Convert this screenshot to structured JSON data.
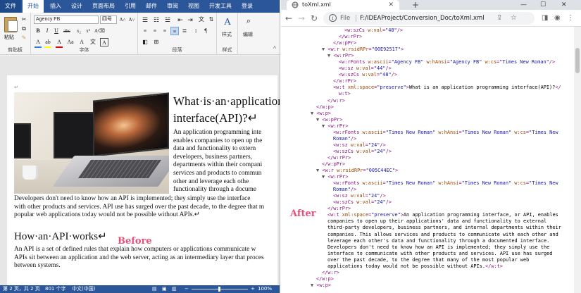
{
  "word": {
    "ribbon_tabs": [
      "文件",
      "开始",
      "插入",
      "设计",
      "页面布局",
      "引用",
      "邮件",
      "审阅",
      "视图",
      "开发工具",
      "登录"
    ],
    "active_tab": "开始",
    "paste_label": "粘贴",
    "clipboard_label": "剪贴板",
    "font_name": "Agency FB",
    "font_size": "四号",
    "font_group_label": "字体",
    "paragraph_group_label": "段落",
    "styles_label": "样式",
    "styles_group_label": "样式",
    "editing_label": "编辑",
    "document": {
      "para_mark": "↵",
      "heading1_lines": [
        "What·is·an·application·pr",
        "interface(API)?↵"
      ],
      "para1_beside": [
        "An application programming inte",
        "enables companies to open up the",
        "data and functionality to extern",
        "developers, business partners,",
        "departments within their compani",
        "services and products to commun",
        "other and leverage each othe",
        "functionality through a docume"
      ],
      "para1_full": [
        "Developers don't need to know how an API is implemented; they simply use the interface",
        "with other products and services. API use has surged over the past decade, to the degree that m",
        "popular web applications today would not be possible without APIs.↵"
      ],
      "heading2": "How·an·API·works↵",
      "para2": [
        "An API is a set of defined rules that explain how computers or applications communicate w",
        "APIs sit between an application and the web server, acting as an intermediary layer that proces",
        "between systems."
      ]
    },
    "before_label": "Before",
    "status": {
      "page": "第 2 页，共 2 页",
      "words": "801 个字",
      "language": "中文(中国)",
      "zoom": "100%"
    }
  },
  "browser": {
    "tab_title": "toXml.xml",
    "new_tab": "+",
    "file_label": "File",
    "url": "F:/IDEAProject/Conversion_Doc/toXml.xml",
    "after_label": "After",
    "xml_lines": [
      [
        4,
        [
          [
            "tag",
            "<w:szCs "
          ],
          [
            "an",
            "w:val"
          ],
          [
            "tag",
            "="
          ],
          [
            "av",
            "\"48\""
          ],
          [
            "tag",
            "/>"
          ]
        ]
      ],
      [
        3,
        [
          [
            "tag",
            "</w:rPr>"
          ]
        ]
      ],
      [
        2,
        [
          [
            "tag",
            "</w:pPr>"
          ]
        ]
      ],
      [
        0,
        [
          [
            "ar",
            "▼ "
          ],
          [
            "tag",
            "<w:r "
          ],
          [
            "an",
            "w:rsidRPr"
          ],
          [
            "tag",
            "="
          ],
          [
            "av",
            "\"00E92517\""
          ],
          [
            "tag",
            ">"
          ]
        ]
      ],
      [
        1,
        [
          [
            "ar",
            "▼ "
          ],
          [
            "tag",
            "<w:rPr>"
          ]
        ]
      ],
      [
        3,
        [
          [
            "tag",
            "<w:rFonts "
          ],
          [
            "an",
            "w:ascii"
          ],
          [
            "tag",
            "="
          ],
          [
            "av",
            "\"Agency FB\""
          ],
          [
            "tag",
            " "
          ],
          [
            "an",
            "w:hAnsi"
          ],
          [
            "tag",
            "="
          ],
          [
            "av",
            "\"Agency FB\""
          ],
          [
            "tag",
            " "
          ],
          [
            "an",
            "w:cs"
          ],
          [
            "tag",
            "="
          ],
          [
            "av",
            "\"Times New Roman\""
          ],
          [
            "tag",
            "/>"
          ]
        ]
      ],
      [
        3,
        [
          [
            "tag",
            "<w:sz "
          ],
          [
            "an",
            "w:val"
          ],
          [
            "tag",
            "="
          ],
          [
            "av",
            "\"44\""
          ],
          [
            "tag",
            "/>"
          ]
        ]
      ],
      [
        3,
        [
          [
            "tag",
            "<w:szCs "
          ],
          [
            "an",
            "w:val"
          ],
          [
            "tag",
            "="
          ],
          [
            "av",
            "\"48\""
          ],
          [
            "tag",
            "/>"
          ]
        ]
      ],
      [
        2,
        [
          [
            "tag",
            "</w:rPr>"
          ]
        ]
      ],
      [
        2,
        [
          [
            "tag",
            "<w:t "
          ],
          [
            "an",
            "xml:space"
          ],
          [
            "tag",
            "="
          ],
          [
            "av",
            "\"preserve\""
          ],
          [
            "tag",
            ">"
          ],
          [
            "tx",
            "What is an application programming interface(API)?"
          ],
          [
            "tag",
            "</"
          ]
        ]
      ],
      [
        3,
        [
          [
            "tag",
            "w:t>"
          ]
        ]
      ],
      [
        1,
        [
          [
            "tag",
            "</w:r>"
          ]
        ]
      ],
      [
        -1,
        [
          [
            "tag",
            "</w:p>"
          ]
        ]
      ],
      [
        -2,
        [
          [
            "ar",
            "▼ "
          ],
          [
            "tag",
            "<w:p>"
          ]
        ]
      ],
      [
        -1,
        [
          [
            "ar",
            "▼ "
          ],
          [
            "tag",
            "<w:pPr>"
          ]
        ]
      ],
      [
        0,
        [
          [
            "ar",
            "▼ "
          ],
          [
            "tag",
            "<w:rPr>"
          ]
        ]
      ],
      [
        2,
        [
          [
            "tag",
            "<w:rFonts "
          ],
          [
            "an",
            "w:ascii"
          ],
          [
            "tag",
            "="
          ],
          [
            "av",
            "\"Times New Roman\""
          ],
          [
            "tag",
            " "
          ],
          [
            "an",
            "w:hAnsi"
          ],
          [
            "tag",
            "="
          ],
          [
            "av",
            "\"Times New Roman\""
          ],
          [
            "tag",
            " "
          ],
          [
            "an",
            "w:cs"
          ],
          [
            "tag",
            "="
          ],
          [
            "av",
            "\"Times New"
          ]
        ]
      ],
      [
        2,
        [
          [
            "av",
            "Roman\""
          ],
          [
            "tag",
            "/>"
          ]
        ]
      ],
      [
        2,
        [
          [
            "tag",
            "<w:sz "
          ],
          [
            "an",
            "w:val"
          ],
          [
            "tag",
            "="
          ],
          [
            "av",
            "\"24\""
          ],
          [
            "tag",
            "/>"
          ]
        ]
      ],
      [
        2,
        [
          [
            "tag",
            "<w:szCs "
          ],
          [
            "an",
            "w:val"
          ],
          [
            "tag",
            "="
          ],
          [
            "av",
            "\"24\""
          ],
          [
            "tag",
            "/>"
          ]
        ]
      ],
      [
        1,
        [
          [
            "tag",
            "</w:rPr>"
          ]
        ]
      ],
      [
        0,
        [
          [
            "tag",
            "</w:pPr>"
          ]
        ]
      ],
      [
        -1,
        [
          [
            "ar",
            "▼ "
          ],
          [
            "tag",
            "<w:r "
          ],
          [
            "an",
            "w:rsidRPr"
          ],
          [
            "tag",
            "="
          ],
          [
            "av",
            "\"005C44EC\""
          ],
          [
            "tag",
            ">"
          ]
        ]
      ],
      [
        0,
        [
          [
            "ar",
            "▼ "
          ],
          [
            "tag",
            "<w:rPr>"
          ]
        ]
      ],
      [
        2,
        [
          [
            "tag",
            "<w:rFonts "
          ],
          [
            "an",
            "w:ascii"
          ],
          [
            "tag",
            "="
          ],
          [
            "av",
            "\"Times New Roman\""
          ],
          [
            "tag",
            " "
          ],
          [
            "an",
            "w:hAnsi"
          ],
          [
            "tag",
            "="
          ],
          [
            "av",
            "\"Times New Roman\""
          ],
          [
            "tag",
            " "
          ],
          [
            "an",
            "w:cs"
          ],
          [
            "tag",
            "="
          ],
          [
            "av",
            "\"Times New"
          ]
        ]
      ],
      [
        2,
        [
          [
            "av",
            "Roman\""
          ],
          [
            "tag",
            "/>"
          ]
        ]
      ],
      [
        2,
        [
          [
            "tag",
            "<w:sz "
          ],
          [
            "an",
            "w:val"
          ],
          [
            "tag",
            "="
          ],
          [
            "av",
            "\"24\""
          ],
          [
            "tag",
            "/>"
          ]
        ]
      ],
      [
        2,
        [
          [
            "tag",
            "<w:szCs "
          ],
          [
            "an",
            "w:val"
          ],
          [
            "tag",
            "="
          ],
          [
            "av",
            "\"24\""
          ],
          [
            "tag",
            "/>"
          ]
        ]
      ],
      [
        1,
        [
          [
            "tag",
            "</w:rPr>"
          ]
        ]
      ],
      [
        1,
        [
          [
            "tag",
            "<w:t "
          ],
          [
            "an",
            "xml:space"
          ],
          [
            "tag",
            "="
          ],
          [
            "av",
            "\"preserve\""
          ],
          [
            "tag",
            ">"
          ],
          [
            "tx",
            "An application programming interface, or API, enables"
          ]
        ]
      ],
      [
        1,
        [
          [
            "tx",
            "companies to open up their applications' data and functionality to external"
          ]
        ]
      ],
      [
        1,
        [
          [
            "tx",
            "third-party developers, business partners, and internal departments within their"
          ]
        ]
      ],
      [
        1,
        [
          [
            "tx",
            "companies. This allows services and products to communicate with each other and"
          ]
        ]
      ],
      [
        1,
        [
          [
            "tx",
            "leverage each other's data and functionality through a documented interface."
          ]
        ]
      ],
      [
        1,
        [
          [
            "tx",
            "Developers don't need to know how an API is implemented; they simply use the"
          ]
        ]
      ],
      [
        1,
        [
          [
            "tx",
            "interface to communicate with other products and services. API use has surged"
          ]
        ]
      ],
      [
        1,
        [
          [
            "tx",
            "over the past decade, to the degree that many of the most popular web"
          ]
        ]
      ],
      [
        1,
        [
          [
            "tx",
            "applications today would not be possible without APIs."
          ],
          [
            "tag",
            "</w:t>"
          ]
        ]
      ],
      [
        0,
        [
          [
            "tag",
            "</w:r>"
          ]
        ]
      ],
      [
        -1,
        [
          [
            "tag",
            "</w:p>"
          ]
        ]
      ],
      [
        -2,
        [
          [
            "ar",
            "▼ "
          ],
          [
            "tag",
            "<w:p>"
          ]
        ]
      ]
    ]
  }
}
